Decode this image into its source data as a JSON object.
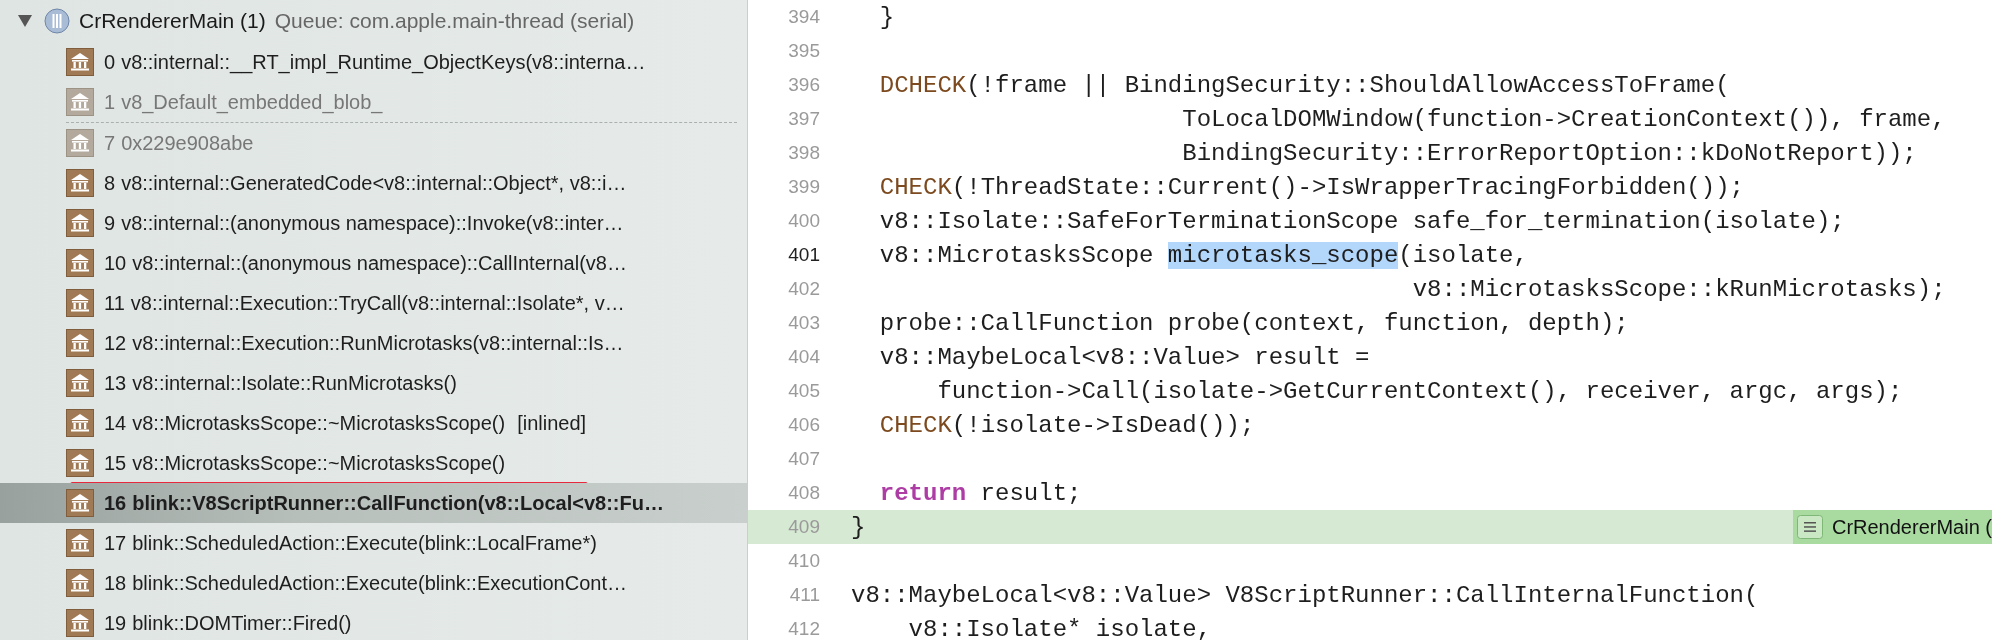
{
  "thread": {
    "expanded": true,
    "name": "CrRendererMain (1)",
    "queue": "Queue: com.apple.main-thread (serial)"
  },
  "frames": [
    {
      "kind": "frame",
      "number": "0",
      "symbol": "v8::internal::__RT_impl_Runtime_ObjectKeys(v8::interna…",
      "dimmed": false,
      "selected": false,
      "underlined": false
    },
    {
      "kind": "frame",
      "number": "1",
      "symbol": "v8_Default_embedded_blob_",
      "dimmed": true,
      "selected": false,
      "underlined": false
    },
    {
      "kind": "separator"
    },
    {
      "kind": "frame",
      "number": "7",
      "symbol": "0x229e908abe",
      "dimmed": true,
      "selected": false,
      "underlined": false
    },
    {
      "kind": "frame",
      "number": "8",
      "symbol": "v8::internal::GeneratedCode<v8::internal::Object*, v8::i…",
      "dimmed": false,
      "selected": false,
      "underlined": false
    },
    {
      "kind": "frame",
      "number": "9",
      "symbol": "v8::internal::(anonymous namespace)::Invoke(v8::inter…",
      "dimmed": false,
      "selected": false,
      "underlined": false
    },
    {
      "kind": "frame",
      "number": "10",
      "symbol": "v8::internal::(anonymous namespace)::CallInternal(v8…",
      "dimmed": false,
      "selected": false,
      "underlined": false
    },
    {
      "kind": "frame",
      "number": "11",
      "symbol": "v8::internal::Execution::TryCall(v8::internal::Isolate*, v…",
      "dimmed": false,
      "selected": false,
      "underlined": false
    },
    {
      "kind": "frame",
      "number": "12",
      "symbol": "v8::internal::Execution::RunMicrotasks(v8::internal::Is…",
      "dimmed": false,
      "selected": false,
      "underlined": false
    },
    {
      "kind": "frame",
      "number": "13",
      "symbol": "v8::internal::Isolate::RunMicrotasks()",
      "dimmed": false,
      "selected": false,
      "underlined": false
    },
    {
      "kind": "frame",
      "number": "14",
      "symbol": "v8::MicrotasksScope::~MicrotasksScope()",
      "suffix": "[inlined]",
      "dimmed": false,
      "selected": false,
      "underlined": false
    },
    {
      "kind": "frame",
      "number": "15",
      "symbol": "v8::MicrotasksScope::~MicrotasksScope()",
      "dimmed": false,
      "selected": false,
      "underlined": true
    },
    {
      "kind": "frame",
      "number": "16",
      "symbol": "blink::V8ScriptRunner::CallFunction(v8::Local<v8::Fu…",
      "dimmed": false,
      "selected": true,
      "underlined": false
    },
    {
      "kind": "frame",
      "number": "17",
      "symbol": "blink::ScheduledAction::Execute(blink::LocalFrame*)",
      "dimmed": false,
      "selected": false,
      "underlined": false
    },
    {
      "kind": "frame",
      "number": "18",
      "symbol": "blink::ScheduledAction::Execute(blink::ExecutionCont…",
      "dimmed": false,
      "selected": false,
      "underlined": false
    },
    {
      "kind": "frame",
      "number": "19",
      "symbol": "blink::DOMTimer::Fired()",
      "dimmed": false,
      "selected": false,
      "underlined": false
    }
  ],
  "code": [
    {
      "number": "394",
      "current": false,
      "tokens": [
        {
          "kind": "plain",
          "text": "  }"
        }
      ]
    },
    {
      "number": "395",
      "current": false
    },
    {
      "number": "396",
      "current": false,
      "tokens": [
        {
          "kind": "macro",
          "text": "  DCHECK"
        },
        {
          "kind": "plain",
          "text": "(!frame || BindingSecurity::ShouldAllowAccessToFrame("
        }
      ]
    },
    {
      "number": "397",
      "current": false,
      "tokens": [
        {
          "kind": "plain",
          "text": "                       ToLocalDOMWindow(function->CreationContext()), frame,"
        }
      ]
    },
    {
      "number": "398",
      "current": false,
      "tokens": [
        {
          "kind": "plain",
          "text": "                       BindingSecurity::ErrorReportOption::kDoNotReport));"
        }
      ]
    },
    {
      "number": "399",
      "current": false,
      "tokens": [
        {
          "kind": "macro",
          "text": "  CHECK"
        },
        {
          "kind": "plain",
          "text": "(!ThreadState::Current()->IsWrapperTracingForbidden());"
        }
      ]
    },
    {
      "number": "400",
      "current": false,
      "tokens": [
        {
          "kind": "plain",
          "text": "  v8::Isolate::SafeForTerminationScope safe_for_termination(isolate);"
        }
      ]
    },
    {
      "number": "401",
      "current": true,
      "tokens": [
        {
          "kind": "plain",
          "text": "  v8::MicrotasksScope "
        },
        {
          "kind": "match",
          "text": "microtasks_scope"
        },
        {
          "kind": "plain",
          "text": "(isolate,"
        }
      ]
    },
    {
      "number": "402",
      "current": false,
      "tokens": [
        {
          "kind": "plain",
          "text": "                                       v8::MicrotasksScope::kRunMicrotasks);"
        }
      ]
    },
    {
      "number": "403",
      "current": false,
      "tokens": [
        {
          "kind": "plain",
          "text": "  probe::CallFunction probe(context, function, depth);"
        }
      ]
    },
    {
      "number": "404",
      "current": false,
      "tokens": [
        {
          "kind": "plain",
          "text": "  v8::MaybeLocal<v8::Value> result ="
        }
      ]
    },
    {
      "number": "405",
      "current": false,
      "tokens": [
        {
          "kind": "plain",
          "text": "      function->Call(isolate->GetCurrentContext(), receiver, argc, args);"
        }
      ]
    },
    {
      "number": "406",
      "current": false,
      "tokens": [
        {
          "kind": "macro",
          "text": "  CHECK"
        },
        {
          "kind": "plain",
          "text": "(!isolate->IsDead());"
        }
      ]
    },
    {
      "number": "407",
      "current": false
    },
    {
      "number": "408",
      "current": false,
      "tokens": [
        {
          "kind": "keyword",
          "text": "  return"
        },
        {
          "kind": "plain",
          "text": " result;"
        }
      ]
    },
    {
      "number": "409",
      "current": false,
      "paused": true,
      "badge": "CrRendererMain (",
      "tokens": [
        {
          "kind": "plain",
          "text": "}"
        }
      ]
    },
    {
      "number": "410",
      "current": false
    },
    {
      "number": "411",
      "current": false,
      "tokens": [
        {
          "kind": "plain",
          "text": "v8::MaybeLocal<v8::Value> V8ScriptRunner::CallInternalFunction("
        }
      ]
    },
    {
      "number": "412",
      "current": false,
      "tokens": [
        {
          "kind": "plain",
          "text": "    v8::Isolate* isolate,"
        }
      ]
    }
  ]
}
